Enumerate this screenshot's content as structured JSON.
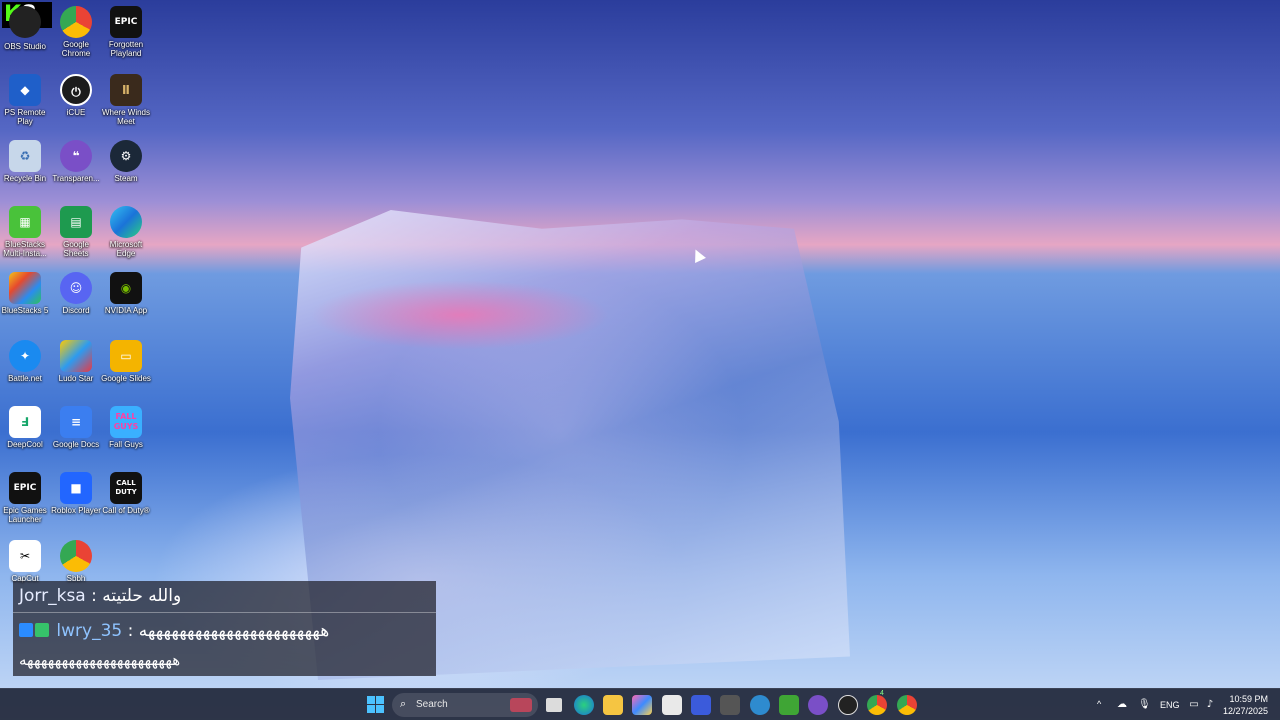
{
  "overlay": {
    "badge_k": "K",
    "badge_num": "8"
  },
  "desktop_icons": [
    {
      "label": "OBS Studio"
    },
    {
      "label": "Google Chrome"
    },
    {
      "label": "Forgotten Playland"
    },
    {
      "label": "PS Remote Play"
    },
    {
      "label": "iCUE"
    },
    {
      "label": "Where Winds Meet"
    },
    {
      "label": "Recycle Bin"
    },
    {
      "label": "Transparen..."
    },
    {
      "label": "Steam"
    },
    {
      "label": "BlueStacks Multi-Insta..."
    },
    {
      "label": "Google Sheets"
    },
    {
      "label": "Microsoft Edge"
    },
    {
      "label": "BlueStacks 5"
    },
    {
      "label": "Discord"
    },
    {
      "label": "NVIDIA App"
    },
    {
      "label": "Battle.net"
    },
    {
      "label": "Ludo Star"
    },
    {
      "label": "Google Slides"
    },
    {
      "label": "DeepCool"
    },
    {
      "label": "Google Docs"
    },
    {
      "label": "Fall Guys"
    },
    {
      "label": "Epic Games Launcher"
    },
    {
      "label": "Roblox Player"
    },
    {
      "label": "Call of Duty®"
    },
    {
      "label": "CapCut"
    },
    {
      "label": "Sbbh"
    }
  ],
  "icon_tiles": {
    "epic_top": "EPIC",
    "epic_launcher": "EPIC",
    "cod": "CALL DUTY",
    "fall_guys": "FALL GUYS"
  },
  "chat": {
    "messages": [
      {
        "user": "Jorr_ksa",
        "sep": " : ",
        "text": "والله حلتيته"
      },
      {
        "user": "lwry_35",
        "sep": " : ",
        "text": "هههههههههههههههههههههههه"
      }
    ],
    "continuation": "ههههههههههههههههههههههه"
  },
  "taskbar": {
    "search_placeholder": "Search",
    "language": "ENG",
    "time": "10:59 PM",
    "date": "12/27/2025",
    "overflow_chevron": "^",
    "chrome_badge": "4"
  },
  "colors": {
    "kick_green": "#53fc18",
    "taskbar_bg": "#202638",
    "accent": "#4cc2ff"
  }
}
